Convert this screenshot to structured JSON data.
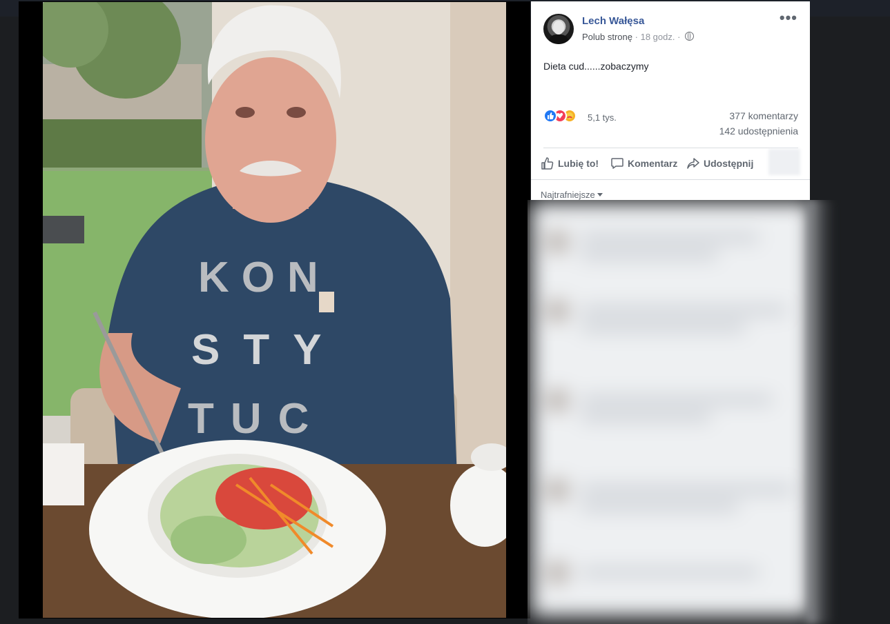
{
  "post": {
    "author": "Lech Wałęsa",
    "like_page_label": "Polub stronę",
    "separator": "·",
    "time": "18 godz.",
    "text": "Dieta cud......zobaczymy",
    "more_label": "•••"
  },
  "stats": {
    "reactions": "5,1 tys.",
    "comments": "377 komentarzy",
    "shares": "142 udostępnienia"
  },
  "actions": {
    "like": "Lubię to!",
    "comment": "Komentarz",
    "share": "Udostępnij"
  },
  "comments_sort": "Najtrafniejsze",
  "photo_shirt_text": [
    "KON",
    "STY",
    "TUC"
  ],
  "icons": {
    "more": "more-options-icon",
    "audience": "globe-icon",
    "reaction_like": "like-reaction-icon",
    "reaction_love": "love-reaction-icon",
    "reaction_care": "care-reaction-icon",
    "like_action": "thumbs-up-icon",
    "comment_action": "comment-bubble-icon",
    "share_action": "share-arrow-icon",
    "sort": "caret-down-icon"
  },
  "colors": {
    "link": "#385898",
    "muted": "#606770",
    "like_blue": "#2078f4",
    "love_red": "#f33e58"
  }
}
